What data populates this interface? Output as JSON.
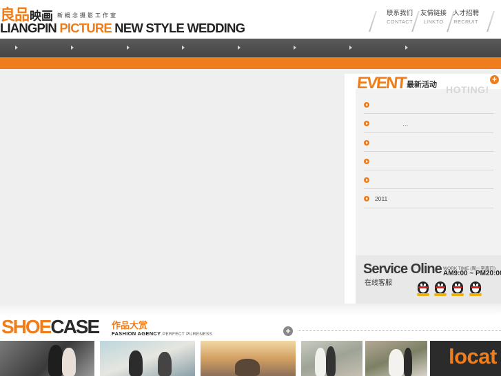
{
  "header": {
    "logo": {
      "cn_big": "良品",
      "cn_mid": "映画",
      "cn_small": "新概念摄影工作室",
      "en_dark_1": "LIANGPIN",
      "en_orange": "PICTURE",
      "en_dark_2": "NEW STYLE WEDDING"
    },
    "links": [
      {
        "cn": "联系我们",
        "en": "CONTACT"
      },
      {
        "cn": "友情链接",
        "en": "LINKTO"
      },
      {
        "cn": "人才招聘",
        "en": "RECRUIT"
      }
    ]
  },
  "nav": {
    "items": [
      "",
      "",
      "",
      "",
      "",
      "",
      "",
      ""
    ]
  },
  "event": {
    "title_en": "EVENT",
    "title_cn": "最新活动",
    "hoting": "HOTING!",
    "plus": "+",
    "items": [
      "",
      "…",
      "",
      "",
      "",
      "2011"
    ]
  },
  "service": {
    "title_en": "Service Oline",
    "title_cn": "在线客服",
    "work_time_label": "WORK TIME (周一至周日)",
    "hours": "AM9:00 ~ PM20:00"
  },
  "showcase": {
    "title_orange": "SHOE",
    "title_dark": "CASE",
    "title_cn": "作品大赏",
    "subtitle": "FASHION AGENCY",
    "subtitle_small": "PERFECT PURENESS",
    "plus": "+",
    "thumb_text": "locat"
  },
  "colors": {
    "accent": "#ef7d1c",
    "nav": "#4f4f4f",
    "panel_bg": "#efefef"
  }
}
